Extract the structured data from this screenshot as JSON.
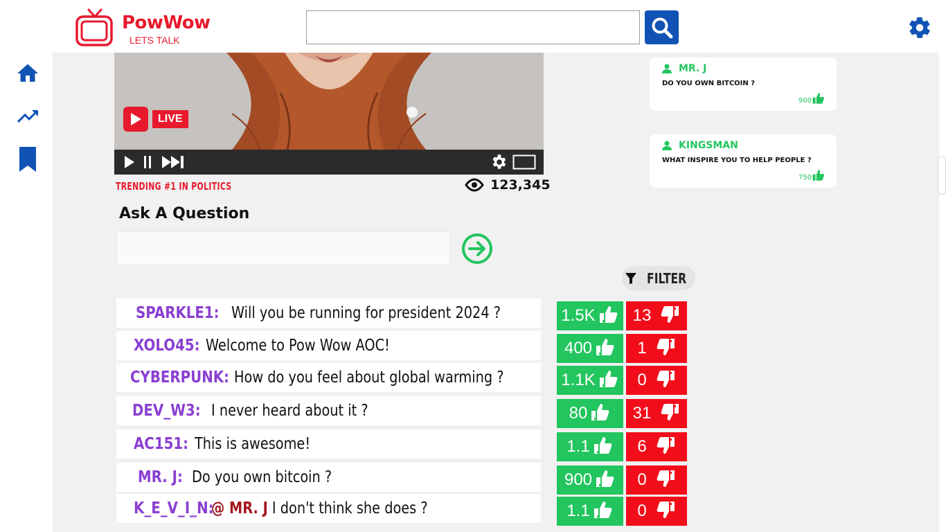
{
  "app": {
    "name": "PowWow",
    "tagline": "LETS TALK",
    "brand_color": "#e8192c",
    "accent_color": "#1153b5"
  },
  "search": {
    "placeholder": "",
    "value": ""
  },
  "nav": {
    "items": [
      {
        "icon": "home-icon"
      },
      {
        "icon": "trending-icon"
      },
      {
        "icon": "bookmark-icon"
      }
    ]
  },
  "video": {
    "live_label": "LIVE",
    "trending_text": "TRENDING #1  IN POLITICS",
    "views": "123,345"
  },
  "ask": {
    "title": "Ask A Question",
    "placeholder": ""
  },
  "filter": {
    "label": "FILTER"
  },
  "chat": [
    {
      "user": "SPARKLE1:",
      "message": "Will you be running for president 2024 ?",
      "mention": "",
      "likes": "1.5K",
      "dislikes": "13"
    },
    {
      "user": "XOLO45:",
      "message": "Welcome to Pow Wow AOC!",
      "mention": "",
      "likes": "400",
      "dislikes": "1"
    },
    {
      "user": "CYBERPUNK:",
      "message": "How do you feel about global warming ?",
      "mention": "",
      "likes": "1.1K",
      "dislikes": "0"
    },
    {
      "user": "DEV_W3:",
      "message": "I never heard about it ?",
      "mention": "",
      "likes": "80",
      "dislikes": "31"
    },
    {
      "user": "AC151:",
      "message": "This is awesome!",
      "mention": "",
      "likes": "1.1",
      "dislikes": "6"
    },
    {
      "user": "MR. J:",
      "message": "Do you own bitcoin ?",
      "mention": "",
      "likes": "900",
      "dislikes": "0"
    },
    {
      "user": "K_E_V_I_N:",
      "message": "I don't think she does  ?",
      "mention": "@ MR. J",
      "likes": "1.1",
      "dislikes": "0"
    }
  ],
  "questions": [
    {
      "user": "MR. J",
      "text": "DO YOU OWN BITCOIN ?",
      "likes": "900"
    },
    {
      "user": "KINGSMAN",
      "text": "WHAT INSPIRE YOU TO HELP PEOPLE ?",
      "likes": "750"
    }
  ]
}
